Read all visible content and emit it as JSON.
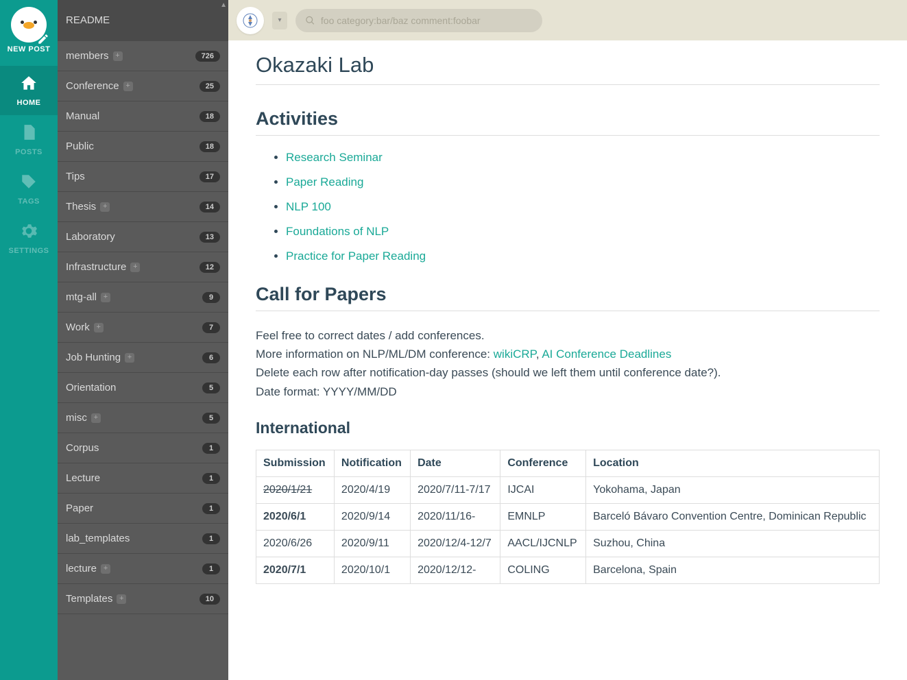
{
  "rail": {
    "new_post": "NEW POST",
    "items": [
      {
        "id": "home",
        "label": "HOME",
        "active": true
      },
      {
        "id": "posts",
        "label": "POSTS",
        "active": false
      },
      {
        "id": "tags",
        "label": "TAGS",
        "active": false
      },
      {
        "id": "settings",
        "label": "SETTINGS",
        "active": false
      }
    ]
  },
  "sidebar": {
    "readme": "README",
    "categories": [
      {
        "name": "members",
        "count": "726",
        "expandable": true
      },
      {
        "name": "Conference",
        "count": "25",
        "expandable": true
      },
      {
        "name": "Manual",
        "count": "18",
        "expandable": false
      },
      {
        "name": "Public",
        "count": "18",
        "expandable": false
      },
      {
        "name": "Tips",
        "count": "17",
        "expandable": false
      },
      {
        "name": "Thesis",
        "count": "14",
        "expandable": true
      },
      {
        "name": "Laboratory",
        "count": "13",
        "expandable": false
      },
      {
        "name": "Infrastructure",
        "count": "12",
        "expandable": true
      },
      {
        "name": "mtg-all",
        "count": "9",
        "expandable": true
      },
      {
        "name": "Work",
        "count": "7",
        "expandable": true
      },
      {
        "name": "Job Hunting",
        "count": "6",
        "expandable": true
      },
      {
        "name": "Orientation",
        "count": "5",
        "expandable": false
      },
      {
        "name": "misc",
        "count": "5",
        "expandable": true
      },
      {
        "name": "Corpus",
        "count": "1",
        "expandable": false
      },
      {
        "name": "Lecture",
        "count": "1",
        "expandable": false
      },
      {
        "name": "Paper",
        "count": "1",
        "expandable": false
      },
      {
        "name": "lab_templates",
        "count": "1",
        "expandable": false
      },
      {
        "name": "lecture",
        "count": "1",
        "expandable": true
      },
      {
        "name": "Templates",
        "count": "10",
        "expandable": true
      }
    ]
  },
  "search": {
    "placeholder": "foo category:bar/baz comment:foobar"
  },
  "page": {
    "title": "Okazaki Lab",
    "activities_heading": "Activities",
    "activities": [
      "Research Seminar",
      "Paper Reading",
      "NLP 100",
      "Foundations of NLP",
      "Practice for Paper Reading"
    ],
    "cfp_heading": "Call for Papers",
    "cfp_p1": "Feel free to correct dates / add conferences.",
    "cfp_p2_prefix": "More information on NLP/ML/DM conference: ",
    "cfp_p2_link1": "wikiCRP",
    "cfp_p2_sep": ", ",
    "cfp_p2_link2": "AI Conference Deadlines",
    "cfp_p3": "Delete each row after notification-day passes (should we left them until conference date?).",
    "cfp_p4": "Date format: YYYY/MM/DD",
    "intl_heading": "International",
    "table": {
      "headers": [
        "Submission",
        "Notification",
        "Date",
        "Conference",
        "Location"
      ],
      "rows": [
        {
          "submission": "2020/1/21",
          "sub_strike": true,
          "notification": "2020/4/19",
          "date": "2020/7/11-7/17",
          "conference": "IJCAI",
          "location": "Yokohama, Japan"
        },
        {
          "submission": "2020/6/1",
          "sub_bold": true,
          "notification": "2020/9/14",
          "date": "2020/11/16-",
          "conference": "EMNLP",
          "location": "Barceló Bávaro Convention Centre, Dominican Republic"
        },
        {
          "submission": "2020/6/26",
          "notification": "2020/9/11",
          "date": "2020/12/4-12/7",
          "conference": "AACL/IJCNLP",
          "location": "Suzhou, China"
        },
        {
          "submission": "2020/7/1",
          "sub_bold": true,
          "notification": "2020/10/1",
          "date": "2020/12/12-",
          "conference": "COLING",
          "location": "Barcelona, Spain"
        }
      ]
    }
  }
}
